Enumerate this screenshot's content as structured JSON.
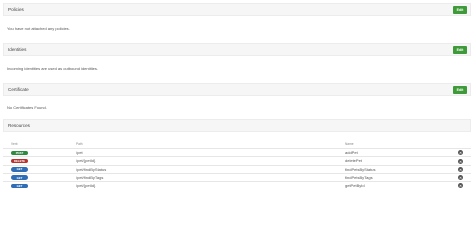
{
  "policies": {
    "title": "Policies",
    "edit_label": "Edit",
    "body": "You have not attached any policies."
  },
  "identities": {
    "title": "Identities",
    "edit_label": "Edit",
    "body": "Incoming identities are used as outbound identities."
  },
  "certificate": {
    "title": "Certificate",
    "edit_label": "Edit",
    "body": "No Certificates Found."
  },
  "resources": {
    "title": "Resources",
    "columns": {
      "verb": "Verb",
      "path": "Path",
      "name": "Name"
    },
    "rows": [
      {
        "verb": "POST",
        "color": "#2e8b3e",
        "path": "/pet",
        "name": "addPet"
      },
      {
        "verb": "DELETE",
        "color": "#b8322e",
        "path": "/pet/{petId}",
        "name": "deletePet"
      },
      {
        "verb": "GET",
        "color": "#2f6db5",
        "path": "/pet/findByStatus",
        "name": "findPetsByStatus"
      },
      {
        "verb": "GET",
        "color": "#2f6db5",
        "path": "/pet/findByTags",
        "name": "findPetsByTags"
      },
      {
        "verb": "GET",
        "color": "#2f6db5",
        "path": "/pet/{petId}",
        "name": "getPetById"
      }
    ]
  }
}
